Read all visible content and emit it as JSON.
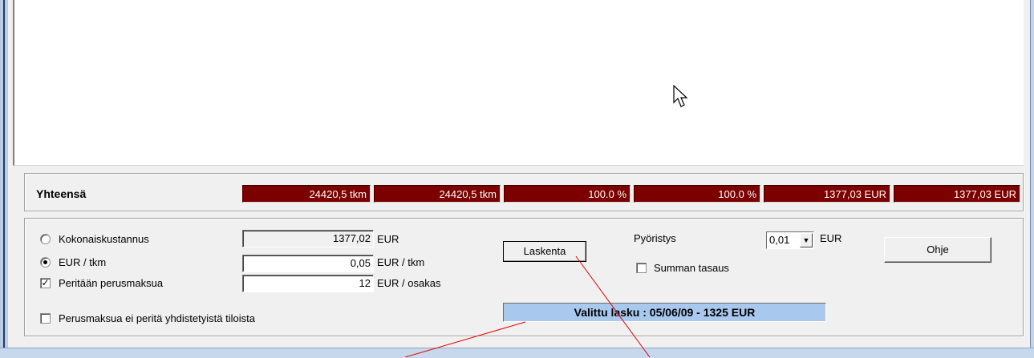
{
  "totals": {
    "label": "Yhteensä",
    "values": [
      "24420,5 tkm",
      "24420,5 tkm",
      "100.0  %",
      "100.0  %",
      "1377,03  EUR",
      "1377,03  EUR"
    ]
  },
  "options": {
    "kokonaiskustannus": {
      "label": "Kokonaiskustannus",
      "value": "1377,02",
      "unit": "EUR",
      "selected": false
    },
    "eur_tkm": {
      "label": "EUR / tkm",
      "value": "0,05",
      "unit": "EUR / tkm",
      "selected": true
    },
    "perusmaksu": {
      "label": "Peritään perusmaksua",
      "value": "12",
      "unit": "EUR / osakas",
      "checked": true
    },
    "yhdistetyt": {
      "label": "Perusmaksua ei peritä yhdistetyistä tiloista",
      "checked": false
    }
  },
  "buttons": {
    "laskenta": "Laskenta",
    "ohje": "Ohje"
  },
  "rounding": {
    "label": "Pyöristys",
    "value": "0,01",
    "unit": "EUR"
  },
  "summan_tasaus": {
    "label": "Summan tasaus",
    "checked": false
  },
  "selected_invoice": "Valittu lasku : 05/06/09 - 1325 EUR",
  "icons": {
    "pointer": "mouse-pointer-icon",
    "dropdown": "chevron-down-icon"
  },
  "colors": {
    "totals_bg": "#7d0000",
    "invoice_bg": "#a9c8ee",
    "annotation_line": "#e00000"
  }
}
